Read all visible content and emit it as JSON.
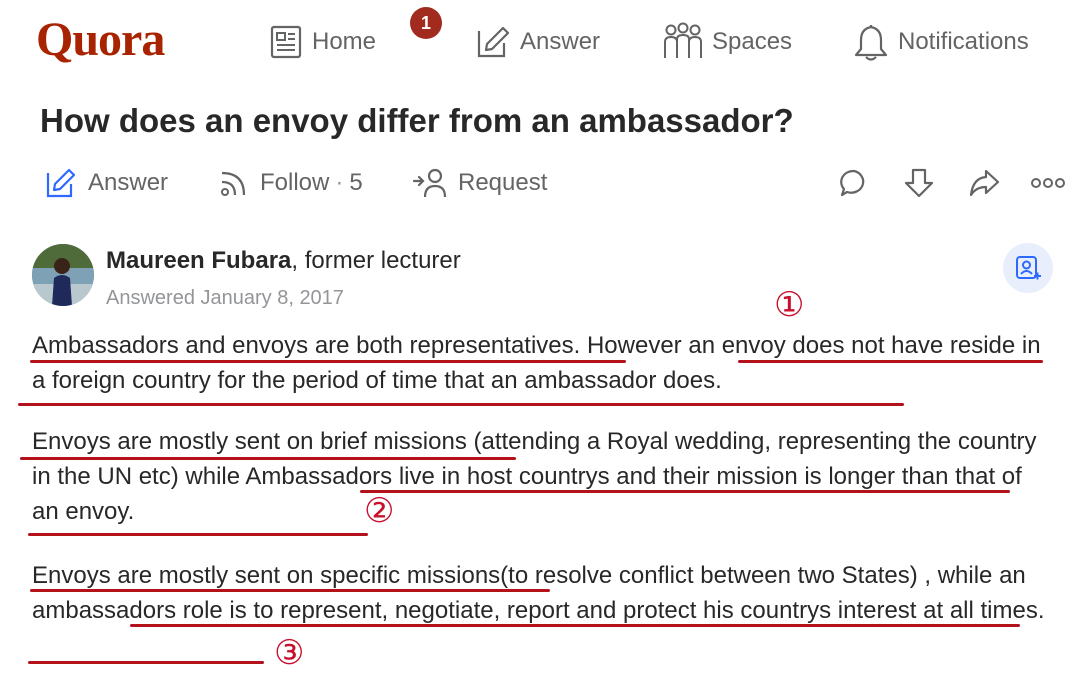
{
  "nav": {
    "logo": "Quora",
    "home": "Home",
    "badge": "1",
    "answer": "Answer",
    "spaces": "Spaces",
    "notifications": "Notifications"
  },
  "question": {
    "title": "How does an envoy differ from an ambassador?",
    "actions": {
      "answer": "Answer",
      "follow": "Follow",
      "follow_sep": "·",
      "follow_count": "5",
      "request": "Request"
    }
  },
  "answer": {
    "author_name": "Maureen Fubara",
    "author_cred": ", former lecturer",
    "answered": "Answered January 8, 2017",
    "paragraphs": [
      "Ambassadors and envoys are both representatives. However an envoy does not have reside in a foreign country for the period of time that an ambassador does.",
      "Envoys are mostly sent on brief missions (attending a Royal wedding, representing the country in the UN etc) while Ambassadors live in host countrys and their mission is longer than that of an envoy.",
      "Envoys are mostly sent on specific missions(to resolve conflict between two States) , while an ambassadors role is to represent, negotiate, report and protect his countrys interest at all times."
    ]
  },
  "annotations": {
    "mark1": "①",
    "mark2": "②",
    "mark3": "③",
    "color": "#b3121b"
  },
  "colors": {
    "brand": "#a82400",
    "badge": "#a12b1e",
    "text": "#282829",
    "muted": "#636466"
  }
}
